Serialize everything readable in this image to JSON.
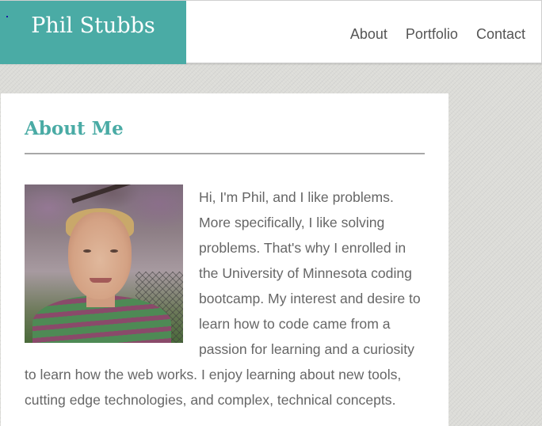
{
  "header": {
    "brand": "Phil Stubbs",
    "nav": [
      {
        "label": "About"
      },
      {
        "label": "Portfolio"
      },
      {
        "label": "Contact"
      }
    ]
  },
  "main": {
    "section_title": "About Me",
    "bio": "Hi, I'm Phil, and I like problems. More specifically, I like solving problems. That's why I enrolled in the University of Minnesota coding bootcamp. My interest and desire to learn how to code came from a passion for learning and a curiosity to learn how the web works. I enjoy learning about new tools, cutting edge technologies, and complex, technical concepts."
  },
  "colors": {
    "accent": "#4aaba5",
    "nav_text": "#555555",
    "body_text": "#666666",
    "page_background": "#dcdcd8"
  }
}
